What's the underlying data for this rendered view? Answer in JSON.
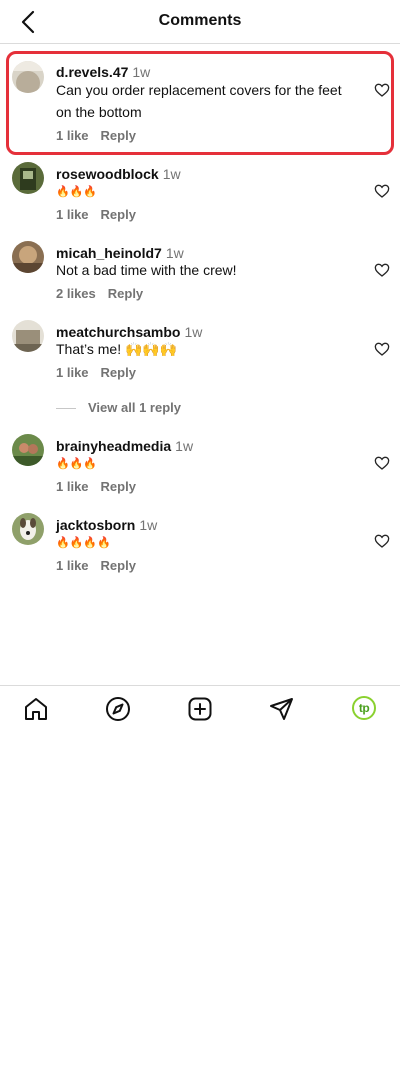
{
  "header": {
    "title": "Comments",
    "back_icon": "chevron-left-icon"
  },
  "comments": [
    {
      "username": "d.revels.47",
      "time": "1w",
      "text": "Can you order replacement covers for the feet on the bottom",
      "likes": "1 like",
      "reply": "Reply",
      "highlighted": true
    },
    {
      "username": "rosewoodblock",
      "time": "1w",
      "text": "🔥🔥🔥",
      "likes": "1 like",
      "reply": "Reply"
    },
    {
      "username": "micah_heinold7",
      "time": "1w",
      "text": "Not a bad time with the crew!",
      "likes": "2 likes",
      "reply": "Reply"
    },
    {
      "username": "meatchurchsambo",
      "time": "1w",
      "text": "That’s me! 🙌🙌🙌",
      "likes": "1 like",
      "reply": "Reply",
      "view_replies": "View all 1 reply"
    },
    {
      "username": "brainyheadmedia",
      "time": "1w",
      "text": "🔥🔥🔥",
      "likes": "1 like",
      "reply": "Reply"
    },
    {
      "username": "jacktosborn",
      "time": "1w",
      "text": "🔥🔥🔥🔥",
      "likes": "1 like",
      "reply": "Reply"
    }
  ],
  "tabbar": {
    "items": [
      "home-icon",
      "explore-icon",
      "new-post-icon",
      "direct-message-icon",
      "profile-avatar"
    ],
    "profile_initials": "tp"
  },
  "colors": {
    "highlight": "#e5303a",
    "secondary_text": "#737373",
    "profile_ring": "#8ad12f"
  }
}
